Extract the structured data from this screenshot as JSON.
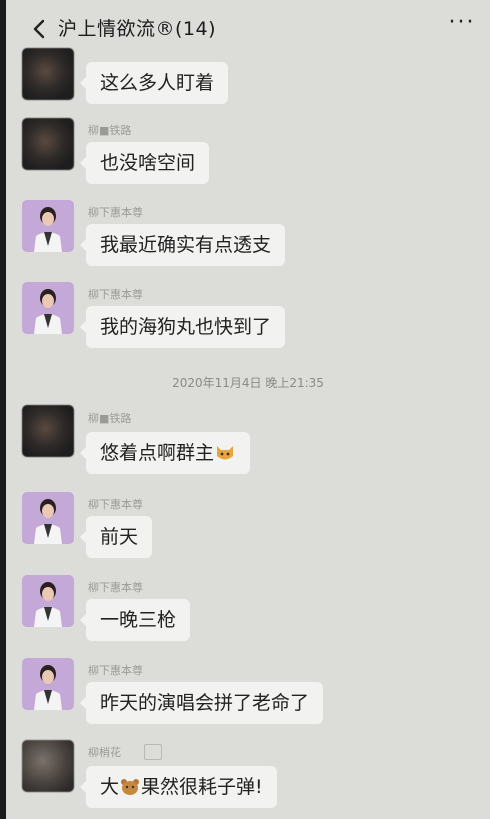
{
  "header": {
    "title": "沪上情欲流®(14)",
    "back_icon": "chevron-left-icon",
    "more_icon": "more-dots-icon",
    "more_label": "···"
  },
  "timestamp": "2020年11月4日 晚上21:35",
  "messages": [
    {
      "avatar": "dark",
      "sender": "",
      "text": "这么多人盯着"
    },
    {
      "avatar": "dark",
      "sender": "柳■铁路",
      "text": "也没啥空间"
    },
    {
      "avatar": "purple",
      "sender": "柳下惠本尊",
      "text": "我最近确实有点透支"
    },
    {
      "avatar": "purple",
      "sender": "柳下惠本尊",
      "text": "我的海狗丸也快到了"
    },
    {
      "avatar": "dark",
      "sender": "柳■铁路",
      "text_before": "悠着点啊群主",
      "emoji": "cat-emoji"
    },
    {
      "avatar": "purple",
      "sender": "柳下惠本尊",
      "text": "前天"
    },
    {
      "avatar": "purple",
      "sender": "柳下惠本尊",
      "text": "一晚三枪"
    },
    {
      "avatar": "purple",
      "sender": "柳下惠本尊",
      "text": "昨天的演唱会拼了老命了"
    },
    {
      "avatar": "gray",
      "sender": "柳梢花",
      "text_before": "大",
      "emoji": "bear-emoji",
      "text_after": "果然很耗子弹!"
    }
  ],
  "colors": {
    "background": "#dcdcd9",
    "bubble": "#f2f2f0",
    "avatar_purple": "#c3a8d8"
  }
}
